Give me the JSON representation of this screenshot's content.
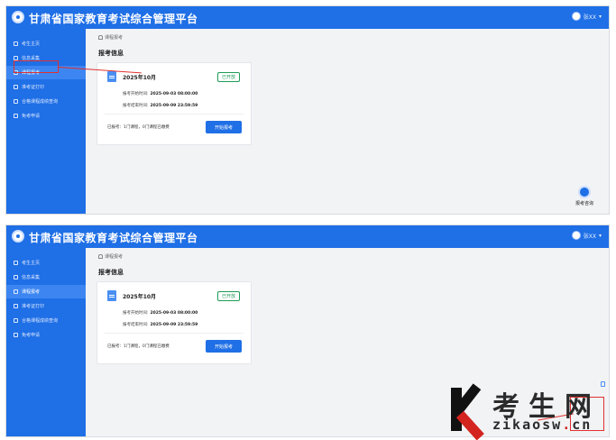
{
  "app": {
    "title": "甘肃省国家教育考试综合管理平台",
    "user_name": "张XX"
  },
  "sidebar": {
    "items": [
      {
        "label": "考生主页"
      },
      {
        "label": "信息采集"
      },
      {
        "label": "课程报考"
      },
      {
        "label": "准考证打印"
      },
      {
        "label": "合格课程成绩查询"
      },
      {
        "label": "免考申请"
      }
    ]
  },
  "breadcrumb": {
    "label": "课程报考"
  },
  "section": {
    "title": "报考信息"
  },
  "exam_card": {
    "name": "2025年10月",
    "status": "已开放",
    "start_label": "报考开始时间:",
    "start_value": "2025-09-03 08:00:00",
    "end_label": "报考结束时间:",
    "end_value": "2025-09-09 23:59:59",
    "summary": "已报考：1门课程，0门课程已缴费",
    "button": "开始报考"
  },
  "help": {
    "label": "报考咨询"
  },
  "watermark": {
    "cn": "考生网",
    "url_prefix": "zikaosw",
    "url_suffix": "cn"
  }
}
